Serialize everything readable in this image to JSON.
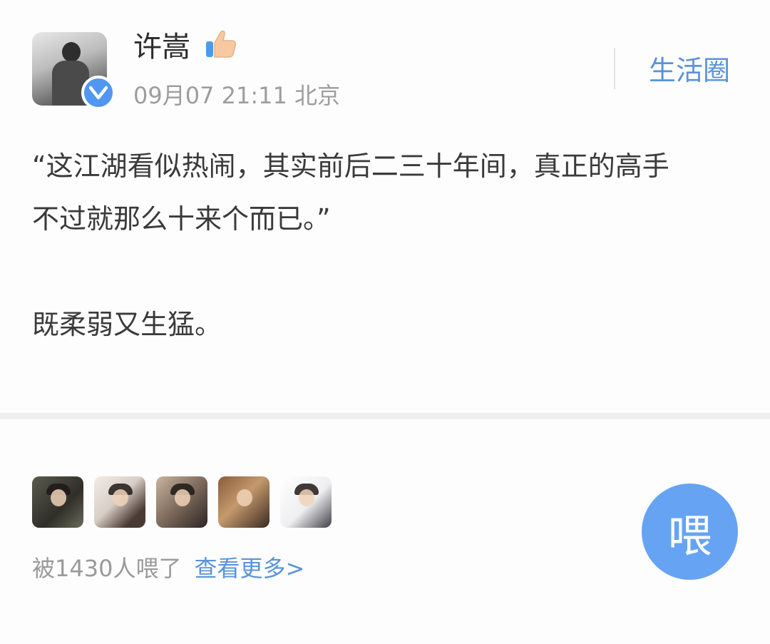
{
  "post": {
    "author": "许嵩",
    "timestamp": "09月07 21:11",
    "location": "北京",
    "circle_link": "生活圈",
    "lines": [
      "“这江湖看似热闹，其实前后二三十年间，真正的高手",
      "不过就那么十来个而已。”",
      "既柔弱又生猛。"
    ]
  },
  "engagement": {
    "likes_text": "被1430人喂了",
    "view_more": "查看更多>",
    "action_label": "喂"
  },
  "icons": {
    "verified": "verified-badge-icon",
    "thumbs_up": "thumbs-up-icon"
  },
  "colors": {
    "accent": "#5a93da",
    "action_button": "#66a3f3",
    "verified_badge": "#4f97f1"
  }
}
